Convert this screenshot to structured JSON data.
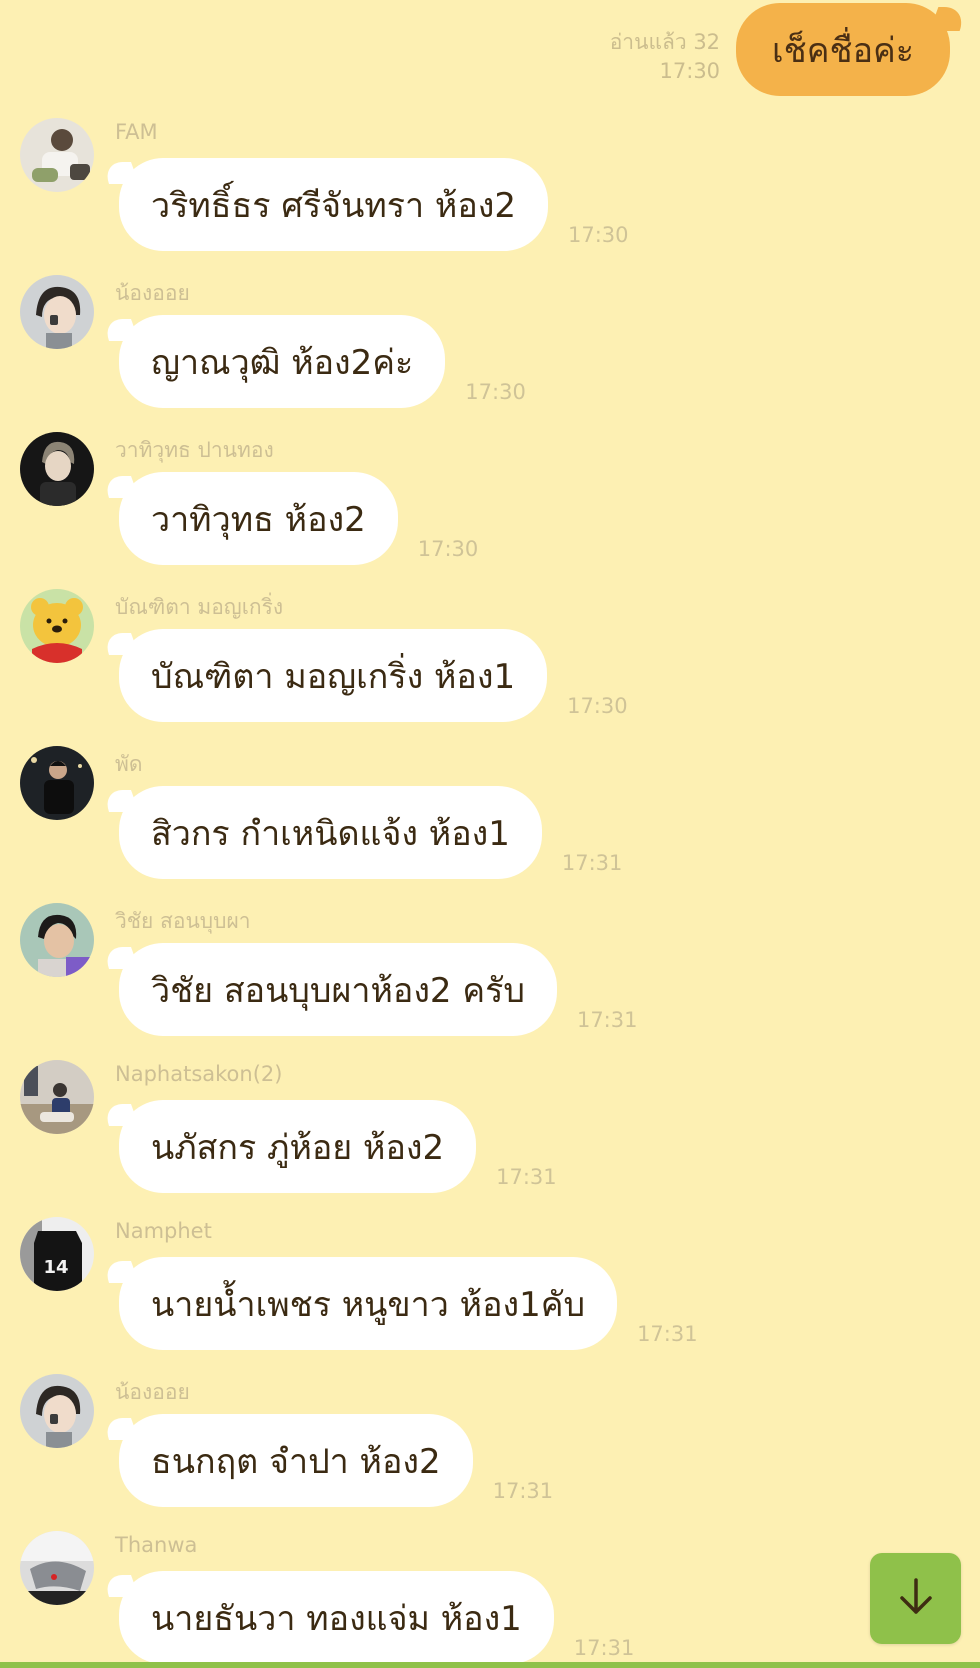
{
  "outgoing": {
    "read_label": "อ่านแล้ว 32",
    "time": "17:30",
    "text": "เช็คชื่อค่ะ"
  },
  "messages": [
    {
      "sender": "FAM",
      "text": "วริทธิ์ธร ศรีจันทรา ห้อง2",
      "time": "17:30"
    },
    {
      "sender": "น้องออย",
      "text": "ญาณวุฒิ ห้อง2ค่ะ",
      "time": "17:30"
    },
    {
      "sender": "วาทิวุทธ  ปานทอง",
      "text": "วาทิวุทธ ห้อง2",
      "time": "17:30"
    },
    {
      "sender": "บัณฑิตา มอญเกริ่ง",
      "text": "บัณฑิตา มอญเกริ่ง ห้อง1",
      "time": "17:30"
    },
    {
      "sender": "พัด",
      "text": "สิวกร กำเหนิดแจ้ง ห้อง1",
      "time": "17:31"
    },
    {
      "sender": "วิชัย   สอนบุบผา",
      "text": "วิชัย สอนบุบผาห้อง2 ครับ",
      "time": "17:31"
    },
    {
      "sender": "Naphatsakon(2)",
      "text": "นภัสกร ภู่ห้อย ห้อง2",
      "time": "17:31"
    },
    {
      "sender": "Namphet",
      "text": "นายน้ำเพชร หนูขาว ห้อง1คับ",
      "time": "17:31"
    },
    {
      "sender": "น้องออย",
      "text": "ธนกฤต จำปา ห้อง2",
      "time": "17:31"
    },
    {
      "sender": "Thanwa",
      "text": "นายธันวา ทองแจ่ม ห้อง1",
      "time": "17:31"
    }
  ],
  "colors": {
    "background": "#fdf0b3",
    "outgoing_bubble": "#f4b24a",
    "incoming_bubble": "#ffffff",
    "accent": "#8fc14a"
  },
  "icons": {
    "scroll_down": "arrow-down-icon"
  }
}
